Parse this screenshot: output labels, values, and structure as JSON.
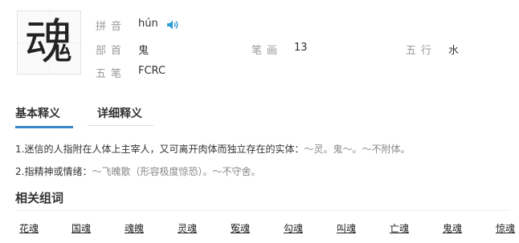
{
  "character": "魂",
  "info": {
    "pinyin_label": "拼音",
    "pinyin": "hún",
    "radical_label": "部首",
    "radical": "鬼",
    "strokes_label": "笔画",
    "strokes": "13",
    "wuxing_label": "五行",
    "wuxing": "水",
    "wubi_label": "五笔",
    "wubi": "FCRC"
  },
  "tabs": [
    {
      "label": "基本释义",
      "active": true
    },
    {
      "label": "详细释义",
      "active": false
    }
  ],
  "definitions": [
    {
      "text": "1.迷信的人指附在人体上主宰人，又可离开肉体而独立存在的实体：",
      "examples": "～灵。鬼～。～不附体。"
    },
    {
      "text": "2.指精神或情绪：",
      "examples": "～飞魄散（形容极度惊恐）。～不守舍。"
    }
  ],
  "related_title": "相关组词",
  "related_words": [
    "花魂",
    "国魂",
    "魂魄",
    "灵魂",
    "冤魂",
    "勾魂",
    "叫魂",
    "亡魂",
    "鬼魂",
    "惊魂"
  ],
  "colors": {
    "accent": "#3a86c8",
    "speaker": "#2d9bd8"
  }
}
